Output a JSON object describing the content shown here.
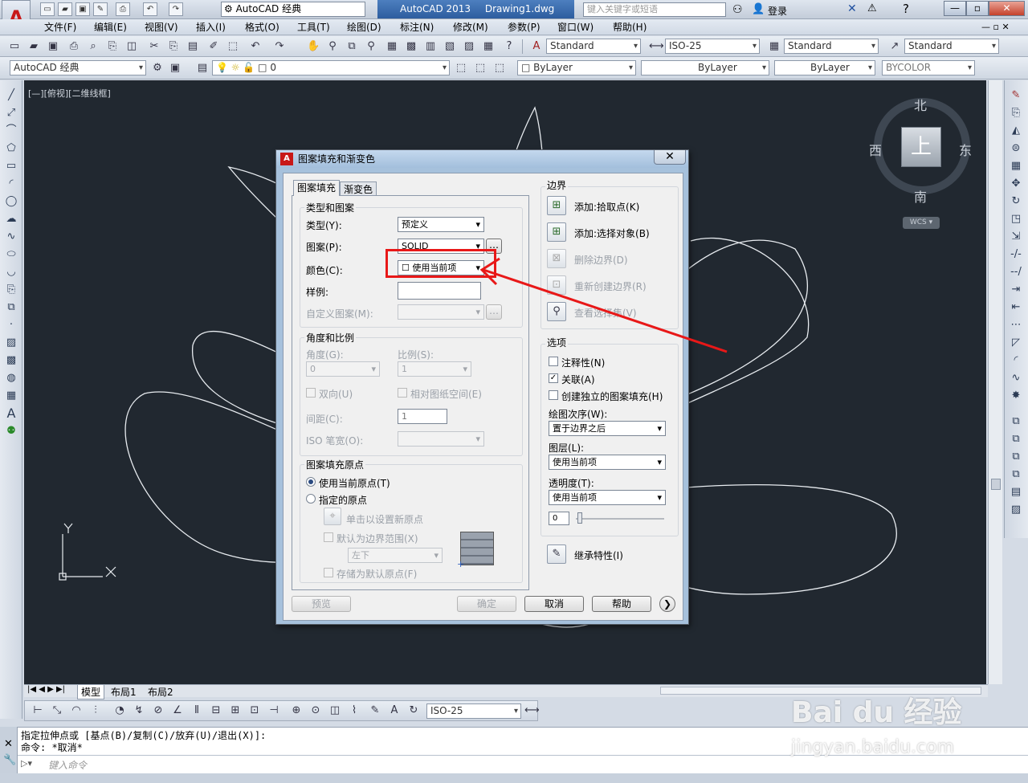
{
  "titlebar": {
    "workspace": "AutoCAD 经典",
    "app_name": "AutoCAD 2013",
    "document": "Drawing1.dwg",
    "search_placeholder": "键入关键字或短语",
    "login": "登录"
  },
  "menu": [
    "文件(F)",
    "编辑(E)",
    "视图(V)",
    "插入(I)",
    "格式(O)",
    "工具(T)",
    "绘图(D)",
    "标注(N)",
    "修改(M)",
    "参数(P)",
    "窗口(W)",
    "帮助(H)"
  ],
  "toolbar1": {
    "text_style": "Standard",
    "dim_style": "ISO-25",
    "table_style": "Standard",
    "multileader_style": "Standard"
  },
  "toolbar2": {
    "workspace": "AutoCAD 经典",
    "layer": "0",
    "color": "ByLayer",
    "linetype": "ByLayer",
    "lineweight": "ByLayer",
    "plotstyle": "BYCOLOR"
  },
  "viewport": {
    "label": "[—][俯视][二维线框]",
    "axis_x": "X",
    "axis_y": "Y"
  },
  "viewcube": {
    "north": "北",
    "south": "南",
    "east": "东",
    "west": "西",
    "top": "上",
    "wcs": "WCS"
  },
  "layout_tabs": [
    "模型",
    "布局1",
    "布局2"
  ],
  "draw_toolbar": {
    "dim_style": "ISO-25"
  },
  "command": {
    "line1": "指定拉伸点或 [基点(B)/复制(C)/放弃(U)/退出(X)]:",
    "line2": "命令: *取消*",
    "placeholder": "键入命令"
  },
  "watermark": {
    "brand": "Bai du 经验",
    "url": "jingyan.baidu.com"
  },
  "dialog": {
    "title": "图案填充和渐变色",
    "tabs": [
      "图案填充",
      "渐变色"
    ],
    "type_pattern": {
      "group": "类型和图案",
      "type_label": "类型(Y):",
      "type_value": "预定义",
      "pattern_label": "图案(P):",
      "pattern_value": "SOLID",
      "color_label": "颜色(C):",
      "color_value": "使用当前项",
      "swatch_label": "样例:",
      "custom_label": "自定义图案(M):"
    },
    "angle_scale": {
      "group": "角度和比例",
      "angle_label": "角度(G):",
      "angle_value": "0",
      "scale_label": "比例(S):",
      "scale_value": "1",
      "double_label": "双向(U)",
      "relative_label": "相对图纸空间(E)",
      "spacing_label": "间距(C):",
      "spacing_value": "1",
      "iso_label": "ISO 笔宽(O):"
    },
    "origin": {
      "group": "图案填充原点",
      "current_label": "使用当前原点(T)",
      "specified_label": "指定的原点",
      "click_label": "单击以设置新原点",
      "default_label": "默认为边界范围(X)",
      "position_value": "左下",
      "store_label": "存储为默认原点(F)"
    },
    "boundary": {
      "group": "边界",
      "add_pick": "添加:拾取点(K)",
      "add_select": "添加:选择对象(B)",
      "remove": "删除边界(D)",
      "recreate": "重新创建边界(R)",
      "view": "查看选择集(V)"
    },
    "options": {
      "group": "选项",
      "annotative": "注释性(N)",
      "associative": "关联(A)",
      "separate": "创建独立的图案填充(H)",
      "draw_order_label": "绘图次序(W):",
      "draw_order_value": "置于边界之后",
      "layer_label": "图层(L):",
      "layer_value": "使用当前项",
      "transparency_label": "透明度(T):",
      "transparency_value": "使用当前项",
      "transparency_amount": "0"
    },
    "inherit": "继承特性(I)",
    "buttons": {
      "preview": "预览",
      "ok": "确定",
      "cancel": "取消",
      "help": "帮助"
    }
  },
  "colors": {
    "canvas": "#212830",
    "highlight": "#e81818",
    "title_accent": "#2d5d9f"
  }
}
